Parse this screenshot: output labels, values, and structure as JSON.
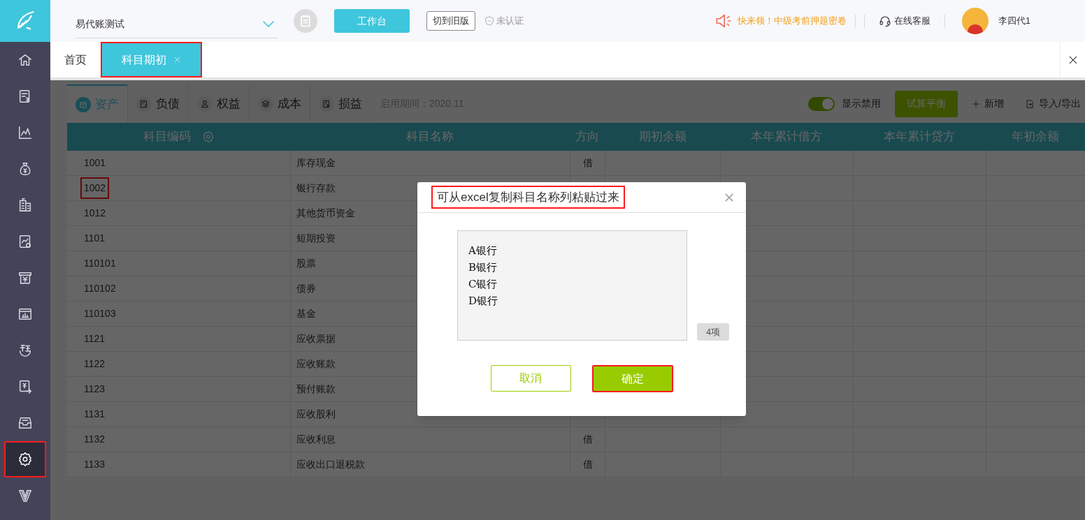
{
  "header": {
    "company": "易代账测试",
    "workbench_button": "工作台",
    "old_version_button": "切到旧版",
    "certification": "未认证",
    "promo": "快来领！中级考前押题密卷",
    "support": "在线客服",
    "user": "李四代1"
  },
  "sidebar": {
    "items": [
      {
        "kind": "home",
        "selected": false,
        "highlighted": false
      },
      {
        "kind": "voucher",
        "selected": false,
        "highlighted": false
      },
      {
        "kind": "chart",
        "selected": false,
        "highlighted": false
      },
      {
        "kind": "moneybag",
        "selected": false,
        "highlighted": false
      },
      {
        "kind": "building",
        "selected": false,
        "highlighted": false
      },
      {
        "kind": "report",
        "selected": false,
        "highlighted": false
      },
      {
        "kind": "receipt",
        "selected": false,
        "highlighted": false
      },
      {
        "kind": "board",
        "selected": false,
        "highlighted": false
      },
      {
        "kind": "tax",
        "selected": false,
        "highlighted": false
      },
      {
        "kind": "exchange",
        "selected": false,
        "highlighted": false
      },
      {
        "kind": "tray",
        "selected": false,
        "highlighted": false
      },
      {
        "kind": "settings",
        "selected": true,
        "highlighted": true
      },
      {
        "kind": "v",
        "selected": false,
        "highlighted": false
      }
    ]
  },
  "tabs": [
    {
      "label": "首页",
      "selected": false,
      "highlighted": false,
      "closable": false
    },
    {
      "label": "科目期初",
      "selected": true,
      "highlighted": true,
      "closable": true
    }
  ],
  "category_tabs": [
    {
      "label": "资产",
      "kind": "safe",
      "selected": true
    },
    {
      "label": "负债",
      "kind": "invoice",
      "selected": false
    },
    {
      "label": "权益",
      "kind": "person",
      "selected": false
    },
    {
      "label": "成本",
      "kind": "layers",
      "selected": false
    },
    {
      "label": "损益",
      "kind": "doc",
      "selected": false
    }
  ],
  "period": "启用期间：2020.11",
  "toolbar": {
    "toggle_label": "显示禁用",
    "toggle_on": true,
    "trial_balance_button": "试算平衡",
    "add_button": "新增",
    "import_export_button": "导入/导出"
  },
  "table": {
    "columns": [
      "科目编码",
      "科目名称",
      "方向",
      "期初余额",
      "本年累计借方",
      "本年累计贷方",
      "年初余额"
    ],
    "rows": [
      {
        "code": "1001",
        "name": "库存现金",
        "direction": "借",
        "highlighted": false
      },
      {
        "code": "1002",
        "name": "银行存款",
        "highlighted": true
      },
      {
        "code": "1012",
        "name": "其他货币资金",
        "highlighted": false
      },
      {
        "code": "1101",
        "name": "短期投资",
        "highlighted": false
      },
      {
        "code": "110101",
        "name": "股票",
        "highlighted": false
      },
      {
        "code": "110102",
        "name": "债券",
        "highlighted": false
      },
      {
        "code": "110103",
        "name": "基金",
        "highlighted": false
      },
      {
        "code": "1121",
        "name": "应收票据",
        "highlighted": false
      },
      {
        "code": "1122",
        "name": "应收账款",
        "highlighted": false
      },
      {
        "code": "1123",
        "name": "预付账款",
        "highlighted": false
      },
      {
        "code": "1131",
        "name": "应收股利",
        "highlighted": false
      },
      {
        "code": "1132",
        "name": "应收利息",
        "direction": "借",
        "highlighted": false
      },
      {
        "code": "1133",
        "name": "应收出口退税款",
        "direction": "借",
        "highlighted": false
      }
    ]
  },
  "dialog": {
    "title": "可从excel复制科目名称列粘贴过来",
    "title_highlighted": true,
    "lines": [
      "A银行",
      "B银行",
      "C银行",
      "D银行"
    ],
    "count": "4项",
    "cancel_button": "取消",
    "confirm_button": "确定",
    "confirm_highlighted": true
  }
}
